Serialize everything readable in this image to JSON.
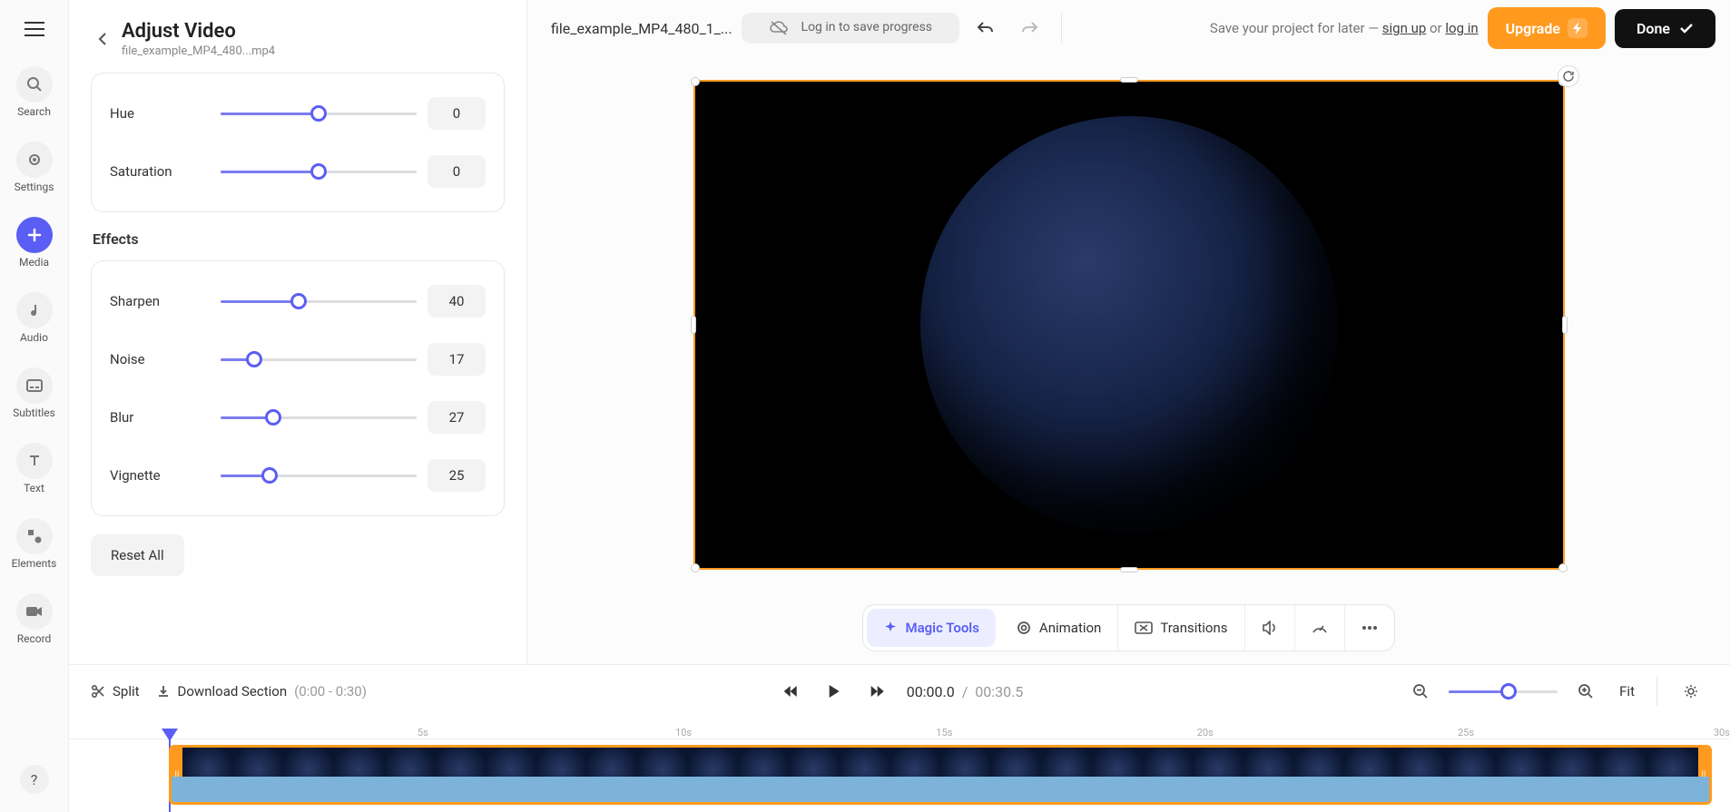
{
  "nav": {
    "items": [
      {
        "label": "Search",
        "icon": "search"
      },
      {
        "label": "Settings",
        "icon": "settings"
      },
      {
        "label": "Media",
        "icon": "plus",
        "active": true
      },
      {
        "label": "Audio",
        "icon": "audio"
      },
      {
        "label": "Subtitles",
        "icon": "subtitles"
      },
      {
        "label": "Text",
        "icon": "text"
      },
      {
        "label": "Elements",
        "icon": "elements"
      },
      {
        "label": "Record",
        "icon": "record"
      }
    ]
  },
  "adjust": {
    "title": "Adjust Video",
    "subtitle": "file_example_MP4_480...mp4",
    "group1": [
      {
        "label": "Hue",
        "value": 0,
        "pos": 50
      },
      {
        "label": "Saturation",
        "value": 0,
        "pos": 50
      }
    ],
    "effects_title": "Effects",
    "effects": [
      {
        "label": "Sharpen",
        "value": 40,
        "pos": 40
      },
      {
        "label": "Noise",
        "value": 17,
        "pos": 17
      },
      {
        "label": "Blur",
        "value": 27,
        "pos": 27
      },
      {
        "label": "Vignette",
        "value": 25,
        "pos": 25
      }
    ],
    "reset": "Reset All"
  },
  "topbar": {
    "project_name": "file_example_MP4_480_1_...",
    "login_prompt": "Log in to save progress",
    "save_prefix": "Save your project for later — ",
    "sign_up": "sign up",
    "or": " or ",
    "log_in": "log in",
    "upgrade": "Upgrade",
    "done": "Done"
  },
  "tools": {
    "magic": "Magic Tools",
    "animation": "Animation",
    "transitions": "Transitions"
  },
  "timeline": {
    "split": "Split",
    "download": "Download Section",
    "download_range": "(0:00 - 0:30)",
    "current": "00:00.0",
    "sep": "/",
    "duration": "00:30.5",
    "fit": "Fit",
    "marks": [
      "5s",
      "10s",
      "15s",
      "20s",
      "25s",
      "30s"
    ]
  }
}
